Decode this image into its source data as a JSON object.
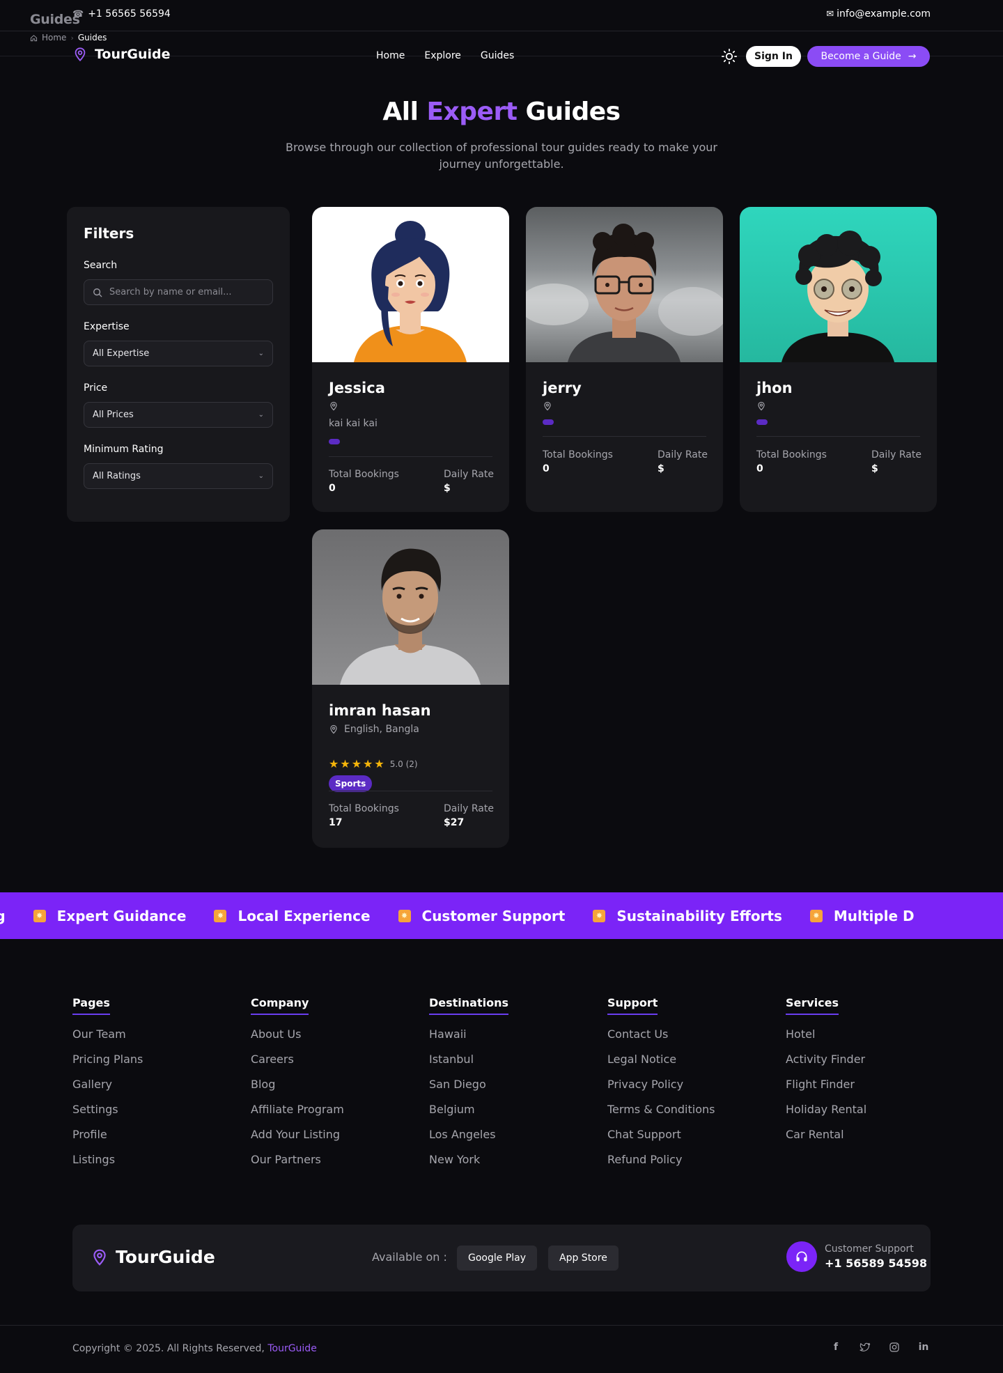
{
  "topbar": {
    "ghost_title": "Guides",
    "phone": "+1 56565 56594",
    "email": "info@example.com"
  },
  "breadcrumb": {
    "home": "Home",
    "current": "Guides"
  },
  "brand": "TourGuide",
  "nav": {
    "links": [
      "Home",
      "Explore",
      "Guides"
    ],
    "sign_in": "Sign In",
    "become": "Become a Guide"
  },
  "hero": {
    "title_pre": "All ",
    "title_accent": "Expert",
    "title_post": " Guides",
    "subtitle": "Browse through our collection of professional tour guides ready to make your journey unforgettable."
  },
  "filters": {
    "title": "Filters",
    "search_label": "Search",
    "search_placeholder": "Search by name or email...",
    "expertise_label": "Expertise",
    "expertise_value": "All Expertise",
    "price_label": "Price",
    "price_value": "All Prices",
    "rating_label": "Minimum Rating",
    "rating_value": "All Ratings"
  },
  "guides": [
    {
      "name": "Jessica",
      "location": "",
      "languages": "kai kai kai",
      "bookings_label": "Total Bookings",
      "bookings": "0",
      "rate_label": "Daily Rate",
      "rate": "$"
    },
    {
      "name": "jerry",
      "location": "",
      "bookings_label": "Total Bookings",
      "bookings": "0",
      "rate_label": "Daily Rate",
      "rate": "$"
    },
    {
      "name": "jhon",
      "location": "",
      "bookings_label": "Total Bookings",
      "bookings": "0",
      "rate_label": "Daily Rate",
      "rate": "$"
    },
    {
      "name": "imran hasan",
      "location": "English, Bangla",
      "rating": "5.0 (2)",
      "stars": 5,
      "tag": "Sports",
      "bookings_label": "Total Bookings",
      "bookings": "17",
      "rate_label": "Daily Rate",
      "rate": "$27"
    }
  ],
  "marquee": [
    "ning",
    "Expert Guidance",
    "Local Experience",
    "Customer Support",
    "Sustainability Efforts",
    "Multiple D"
  ],
  "footer": {
    "columns": [
      {
        "title": "Pages",
        "items": [
          "Our Team",
          "Pricing Plans",
          "Gallery",
          "Settings",
          "Profile",
          "Listings"
        ]
      },
      {
        "title": "Company",
        "items": [
          "About Us",
          "Careers",
          "Blog",
          "Affiliate Program",
          "Add Your Listing",
          "Our Partners"
        ]
      },
      {
        "title": "Destinations",
        "items": [
          "Hawaii",
          "Istanbul",
          "San Diego",
          "Belgium",
          "Los Angeles",
          "New York"
        ]
      },
      {
        "title": "Support",
        "items": [
          "Contact Us",
          "Legal Notice",
          "Privacy Policy",
          "Terms & Conditions",
          "Chat Support",
          "Refund Policy"
        ]
      },
      {
        "title": "Services",
        "items": [
          "Hotel",
          "Activity Finder",
          "Flight Finder",
          "Holiday Rental",
          "Car Rental"
        ]
      }
    ],
    "available_on": "Available on :",
    "google_play": "Google Play",
    "app_store": "App Store",
    "support_label": "Customer Support",
    "support_phone": "+1 56589 54598",
    "copyright": "Copyright © 2025. All Rights Reserved, ",
    "copyright_brand": "TourGuide",
    "socials": [
      "facebook-icon",
      "twitter-icon",
      "instagram-icon",
      "linkedin-icon"
    ]
  },
  "colors": {
    "accent": "#8b4cf5",
    "marquee_bg": "#7b24f7",
    "background": "#0b0b0f",
    "card_bg": "#18181c",
    "star": "#f5b50a",
    "tag": "#5b2bc4"
  }
}
